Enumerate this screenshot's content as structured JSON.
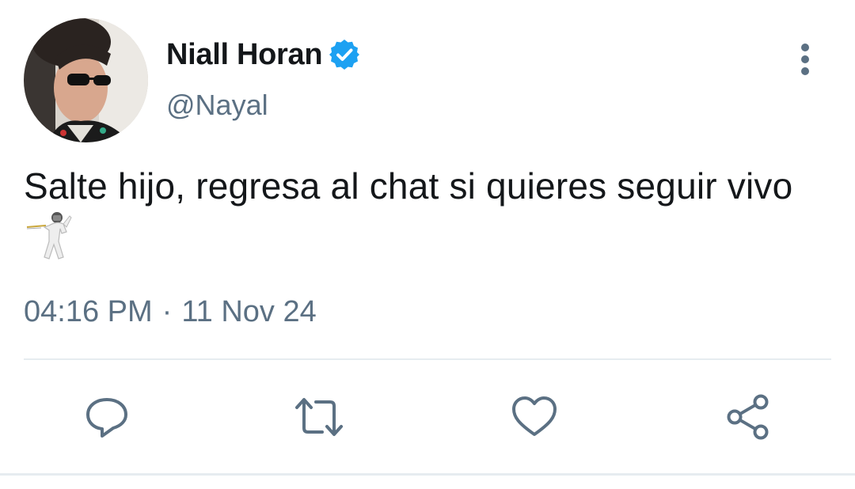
{
  "tweet": {
    "author": {
      "display_name": "Niall Horan",
      "handle": "@Nayal",
      "verified": true
    },
    "text": "Salte hijo, regresa al chat si quieres seguir vivo",
    "emoji": "fencer",
    "time": "04:16 PM",
    "separator": "·",
    "date": "11 Nov 24"
  },
  "actions": {
    "reply_icon": "speech-bubble-icon",
    "retweet_icon": "retweet-icon",
    "like_icon": "heart-icon",
    "share_icon": "share-icon",
    "more_icon": "vertical-dots-icon"
  },
  "colors": {
    "text_primary": "#14171a",
    "text_secondary": "#5b7083",
    "verified_blue": "#1da1f2",
    "icon_gray": "#5b7083",
    "divider": "#e6ecf0"
  }
}
